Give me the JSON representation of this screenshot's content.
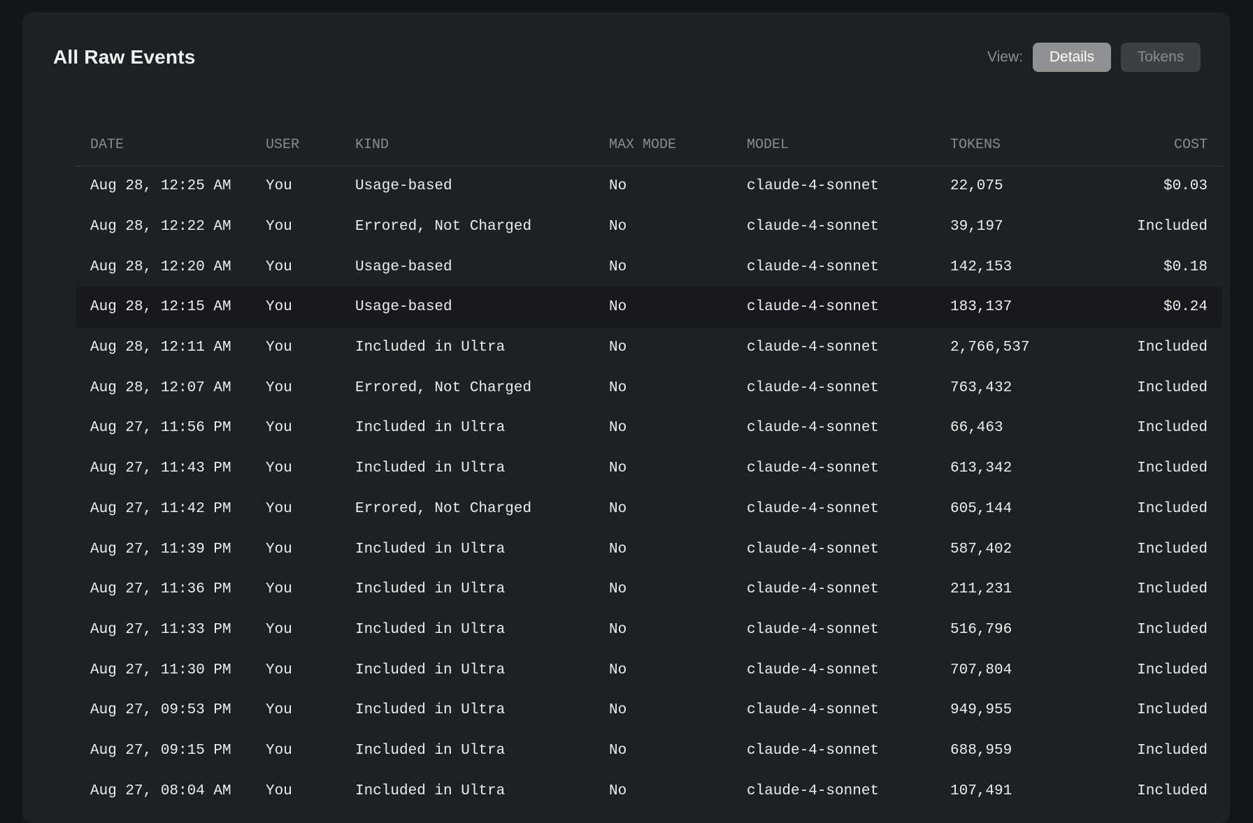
{
  "panel": {
    "title": "All Raw Events",
    "view_label": "View:",
    "view_options": [
      "Details",
      "Tokens"
    ],
    "active_view": "Details"
  },
  "table": {
    "columns": [
      "DATE",
      "USER",
      "KIND",
      "MAX MODE",
      "MODEL",
      "TOKENS",
      "COST"
    ],
    "rows": [
      {
        "date": "Aug 28, 12:25 AM",
        "user": "You",
        "kind": "Usage-based",
        "max_mode": "No",
        "model": "claude-4-sonnet",
        "tokens": "22,075",
        "cost": "$0.03"
      },
      {
        "date": "Aug 28, 12:22 AM",
        "user": "You",
        "kind": "Errored, Not Charged",
        "max_mode": "No",
        "model": "claude-4-sonnet",
        "tokens": "39,197",
        "cost": "Included"
      },
      {
        "date": "Aug 28, 12:20 AM",
        "user": "You",
        "kind": "Usage-based",
        "max_mode": "No",
        "model": "claude-4-sonnet",
        "tokens": "142,153",
        "cost": "$0.18"
      },
      {
        "date": "Aug 28, 12:15 AM",
        "user": "You",
        "kind": "Usage-based",
        "max_mode": "No",
        "model": "claude-4-sonnet",
        "tokens": "183,137",
        "cost": "$0.24"
      },
      {
        "date": "Aug 28, 12:11 AM",
        "user": "You",
        "kind": "Included in Ultra",
        "max_mode": "No",
        "model": "claude-4-sonnet",
        "tokens": "2,766,537",
        "cost": "Included"
      },
      {
        "date": "Aug 28, 12:07 AM",
        "user": "You",
        "kind": "Errored, Not Charged",
        "max_mode": "No",
        "model": "claude-4-sonnet",
        "tokens": "763,432",
        "cost": "Included"
      },
      {
        "date": "Aug 27, 11:56 PM",
        "user": "You",
        "kind": "Included in Ultra",
        "max_mode": "No",
        "model": "claude-4-sonnet",
        "tokens": "66,463",
        "cost": "Included"
      },
      {
        "date": "Aug 27, 11:43 PM",
        "user": "You",
        "kind": "Included in Ultra",
        "max_mode": "No",
        "model": "claude-4-sonnet",
        "tokens": "613,342",
        "cost": "Included"
      },
      {
        "date": "Aug 27, 11:42 PM",
        "user": "You",
        "kind": "Errored, Not Charged",
        "max_mode": "No",
        "model": "claude-4-sonnet",
        "tokens": "605,144",
        "cost": "Included"
      },
      {
        "date": "Aug 27, 11:39 PM",
        "user": "You",
        "kind": "Included in Ultra",
        "max_mode": "No",
        "model": "claude-4-sonnet",
        "tokens": "587,402",
        "cost": "Included"
      },
      {
        "date": "Aug 27, 11:36 PM",
        "user": "You",
        "kind": "Included in Ultra",
        "max_mode": "No",
        "model": "claude-4-sonnet",
        "tokens": "211,231",
        "cost": "Included"
      },
      {
        "date": "Aug 27, 11:33 PM",
        "user": "You",
        "kind": "Included in Ultra",
        "max_mode": "No",
        "model": "claude-4-sonnet",
        "tokens": "516,796",
        "cost": "Included"
      },
      {
        "date": "Aug 27, 11:30 PM",
        "user": "You",
        "kind": "Included in Ultra",
        "max_mode": "No",
        "model": "claude-4-sonnet",
        "tokens": "707,804",
        "cost": "Included"
      },
      {
        "date": "Aug 27, 09:53 PM",
        "user": "You",
        "kind": "Included in Ultra",
        "max_mode": "No",
        "model": "claude-4-sonnet",
        "tokens": "949,955",
        "cost": "Included"
      },
      {
        "date": "Aug 27, 09:15 PM",
        "user": "You",
        "kind": "Included in Ultra",
        "max_mode": "No",
        "model": "claude-4-sonnet",
        "tokens": "688,959",
        "cost": "Included"
      },
      {
        "date": "Aug 27, 08:04 AM",
        "user": "You",
        "kind": "Included in Ultra",
        "max_mode": "No",
        "model": "claude-4-sonnet",
        "tokens": "107,491",
        "cost": "Included"
      }
    ],
    "highlighted_row": 3
  },
  "colors": {
    "page_background": "#151619",
    "panel_background": "#1f2023",
    "active_button": "#909092",
    "inactive_button": "#3e3f42",
    "row_highlight": "#19191b",
    "header_text": "#8a8b90",
    "cell_text": "#eeeeee"
  }
}
